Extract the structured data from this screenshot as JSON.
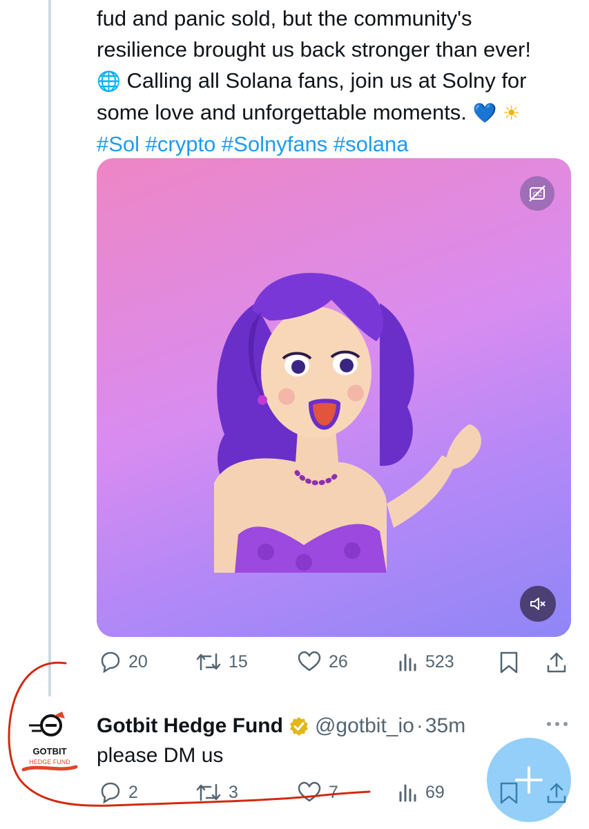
{
  "tweet": {
    "text_lines": [
      "fud and panic sold, but the community's",
      "resilience brought us back stronger than ever!",
      "Calling all Solana fans, join us at Solny for",
      "some love and unforgettable moments."
    ],
    "emoji_globe": "🌐",
    "emoji_heart": "💙",
    "emoji_sun": "☀",
    "hashtags": "#Sol #crypto #Solnyfans #solana",
    "media": {
      "cc_icon": "captions-off-icon",
      "mute_icon": "volume-muted-icon"
    },
    "actions": {
      "replies": "20",
      "reposts": "15",
      "likes": "26",
      "views": "523"
    }
  },
  "reply": {
    "avatar_text_1": "GOTBIT",
    "avatar_text_2": "HEDGE FUND",
    "name": "Gotbit Hedge Fund",
    "handle": "@gotbit_io",
    "separator": "·",
    "time": "35m",
    "text": "please DM us",
    "actions": {
      "replies": "2",
      "reposts": "3",
      "likes": "7",
      "views": "69"
    }
  },
  "colors": {
    "accent": "#1d9bf0",
    "muted": "#536471",
    "annotation": "#d12a10",
    "verified": "#e2b719"
  }
}
